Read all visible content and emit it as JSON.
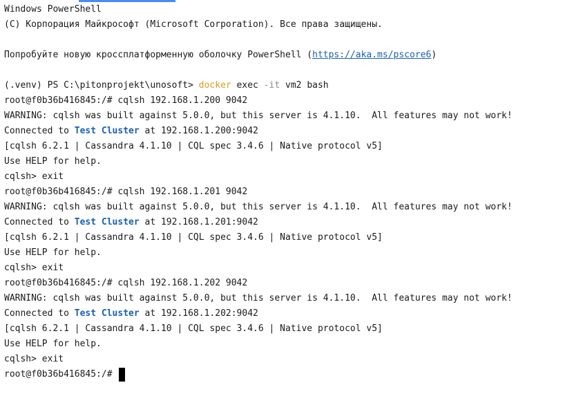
{
  "terminal": {
    "header_line1": "Windows PowerShell",
    "header_line2": "(C) Корпорация Майкрософт (Microsoft Corporation). Все права защищены.",
    "promo_prefix": "Попробуйте новую кроссплатформенную оболочку PowerShell (",
    "promo_link": "https://aka.ms/pscore6",
    "promo_suffix": ")",
    "ps_prompt": "(.venv) PS C:\\pitonprojekt\\unosoft> ",
    "cmd_docker": "docker",
    "cmd_exec": " exec ",
    "cmd_flag": "-it",
    "cmd_rest": " vm2 bash",
    "sessions": [
      {
        "prompt_cmd": "root@f0b36b416845:/# cqlsh 192.168.1.200 9042",
        "warning": "WARNING: cqlsh was built against 5.0.0, but this server is 4.1.10.  All features may not work!",
        "connected_prefix": "Connected to ",
        "cluster": "Test Cluster",
        "connected_suffix": " at 192.168.1.200:9042",
        "version": "[cqlsh 6.2.1 | Cassandra 4.1.10 | CQL spec 3.4.6 | Native protocol v5]",
        "help": "Use HELP for help.",
        "exit": "cqlsh> exit"
      },
      {
        "prompt_cmd": "root@f0b36b416845:/# cqlsh 192.168.1.201 9042",
        "warning": "WARNING: cqlsh was built against 5.0.0, but this server is 4.1.10.  All features may not work!",
        "connected_prefix": "Connected to ",
        "cluster": "Test Cluster",
        "connected_suffix": " at 192.168.1.201:9042",
        "version": "[cqlsh 6.2.1 | Cassandra 4.1.10 | CQL spec 3.4.6 | Native protocol v5]",
        "help": "Use HELP for help.",
        "exit": "cqlsh> exit"
      },
      {
        "prompt_cmd": "root@f0b36b416845:/# cqlsh 192.168.1.202 9042",
        "warning": "WARNING: cqlsh was built against 5.0.0, but this server is 4.1.10.  All features may not work!",
        "connected_prefix": "Connected to ",
        "cluster": "Test Cluster",
        "connected_suffix": " at 192.168.1.202:9042",
        "version": "[cqlsh 6.2.1 | Cassandra 4.1.10 | CQL spec 3.4.6 | Native protocol v5]",
        "help": "Use HELP for help.",
        "exit": "cqlsh> exit"
      }
    ],
    "final_prompt": "root@f0b36b416845:/# ",
    "colors": {
      "docker": "#d4a017",
      "flag": "#8a8a8a",
      "cluster": "#1a5fb4",
      "link": "#1a5fb4",
      "tab_indicator": "#4a8af4"
    }
  }
}
